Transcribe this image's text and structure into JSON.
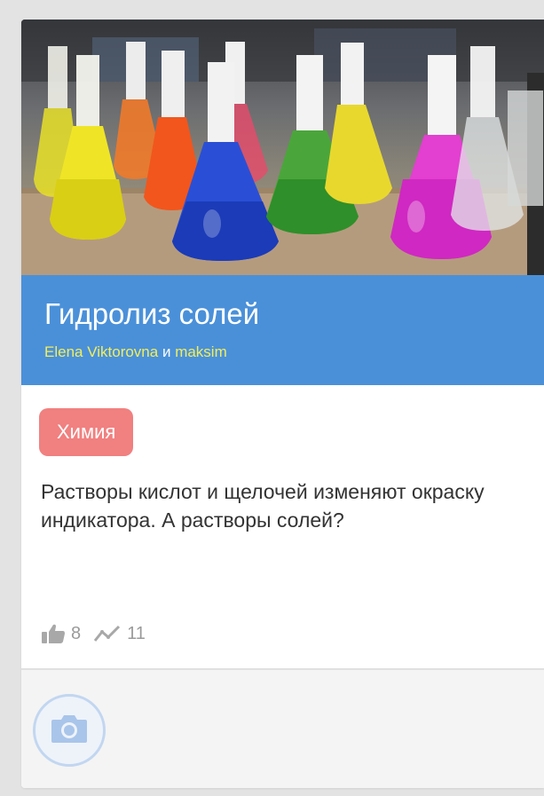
{
  "card": {
    "title": "Гидролиз солей",
    "authors": [
      "Elena Viktorovna",
      "maksim"
    ],
    "authors_conjunction": "и",
    "subject_tag": "Химия",
    "description": "Растворы кислот и щелочей изменяют окраску индикатора. А растворы солей?",
    "likes_count": "8",
    "views_count": "11",
    "cover_image": "chemistry-flasks-photo"
  },
  "icons": {
    "likes": "thumbs-up-icon",
    "views": "trend-line-icon",
    "upload": "camera-icon"
  },
  "colors": {
    "title_band": "#4a90d9",
    "author_link": "#f2ee5a",
    "tag_background": "#f18080",
    "footer_background": "#f4f4f4",
    "camera_accent": "#a9c5ea"
  }
}
